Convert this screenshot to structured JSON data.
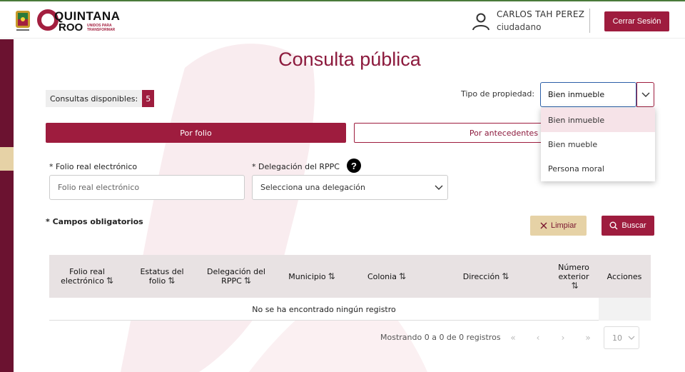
{
  "header": {
    "logo_line1": "QUINTANA",
    "logo_line2": "ROO",
    "logo_tagline": "UNIDOS PARA TRANSFORMAR",
    "user_name": "CARLOS TAH PEREZ",
    "user_role": "ciudadano",
    "logout_label": "Cerrar Sesión"
  },
  "page": {
    "title": "Consulta pública",
    "quota_label": "Consultas disponibles:",
    "quota_count": "5",
    "tipo_label": "Tipo de propiedad:",
    "tipo_selected": "Bien inmueble"
  },
  "dropdown": {
    "options": [
      "Bien inmueble",
      "Bien mueble",
      "Persona moral"
    ]
  },
  "tabs": {
    "folio": "Por folio",
    "antecedentes": "Por antecedentes"
  },
  "form": {
    "folio_label": "* Folio real electrónico",
    "folio_placeholder": "Folio real electrónico",
    "delegacion_label": "* Delegación del RPPC",
    "delegacion_placeholder": "Selecciona una delegación",
    "required_note": "* Campos obligatorios",
    "limpiar_label": "Limpiar",
    "buscar_label": "Buscar"
  },
  "table": {
    "columns": [
      {
        "line1": "Folio real",
        "line2": "electrónico"
      },
      {
        "line1": "Estatus del",
        "line2": "folio"
      },
      {
        "line1": "Delegación del",
        "line2": "RPPC"
      },
      {
        "line1": "Municipio",
        "line2": ""
      },
      {
        "line1": "Colonia",
        "line2": ""
      },
      {
        "line1": "Dirección",
        "line2": ""
      },
      {
        "line1": "Número",
        "line2": "exterior"
      },
      {
        "line1": "Acciones",
        "line2": ""
      }
    ],
    "empty_message": "No se ha encontrado ningún registro"
  },
  "pagination": {
    "info": "Mostrando 0 a 0 de 0 registros",
    "page_size": "10"
  },
  "colors": {
    "brand": "#9e1c3e",
    "gold": "#e6d2a6",
    "sidebar": "#6b1230"
  }
}
